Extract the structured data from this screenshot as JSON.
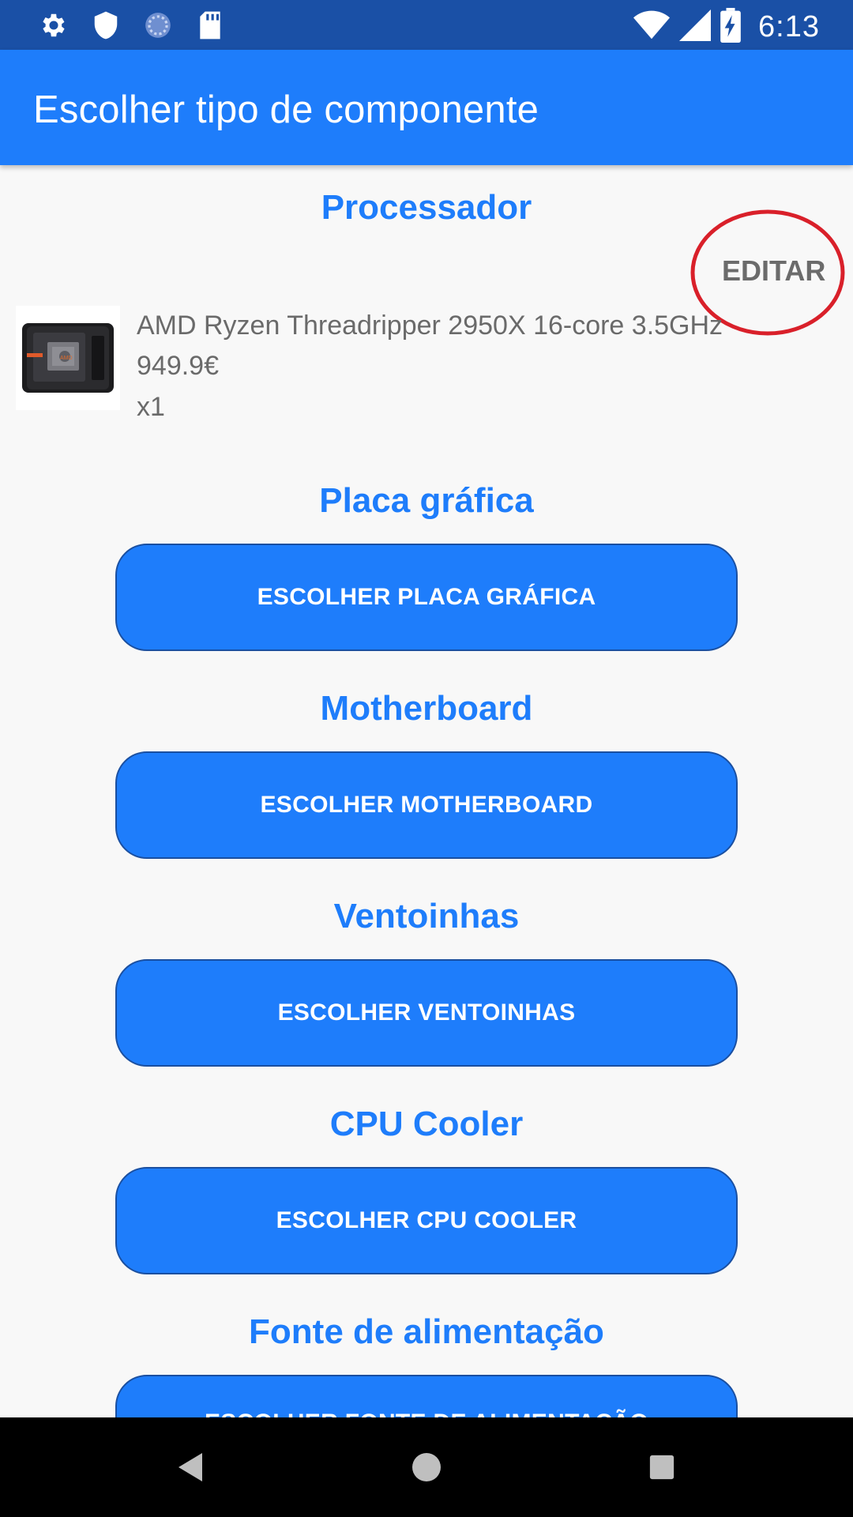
{
  "status_bar": {
    "time": "6:13",
    "icons_left": [
      "gear-icon",
      "shield-icon",
      "sync-icon",
      "sd-card-icon"
    ],
    "icons_right": [
      "wifi-icon",
      "signal-icon",
      "battery-charging-icon"
    ]
  },
  "app_bar": {
    "title": "Escolher tipo de componente"
  },
  "processor": {
    "title": "Processador",
    "edit_label": "EDITAR",
    "product": {
      "name": "AMD Ryzen Threadripper 2950X 16-core 3.5GHz",
      "price": "949.9€",
      "quantity": "x1",
      "image_icon": "cpu-box-image"
    }
  },
  "sections": [
    {
      "title": "Placa gráfica",
      "button_label": "ESCOLHER PLACA GRÁFICA"
    },
    {
      "title": "Motherboard",
      "button_label": "ESCOLHER MOTHERBOARD"
    },
    {
      "title": "Ventoinhas",
      "button_label": "ESCOLHER VENTOINHAS"
    },
    {
      "title": "CPU Cooler",
      "button_label": "ESCOLHER CPU COOLER"
    },
    {
      "title": "Fonte de alimentação",
      "button_label": "ESCOLHER FONTE DE ALIMENTAÇÃO"
    }
  ],
  "nav_bar": {
    "icons": [
      "back-icon",
      "home-icon",
      "recents-icon"
    ]
  },
  "colors": {
    "status_bar": "#1a50a6",
    "app_bar": "#1e7dfb",
    "accent": "#1e7dfb",
    "annotation_circle": "#d9202a"
  }
}
